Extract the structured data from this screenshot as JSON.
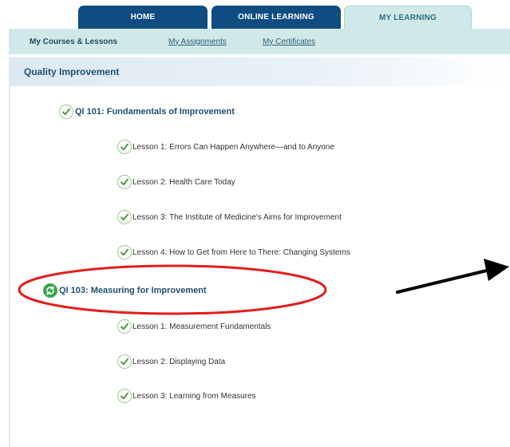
{
  "tabs": [
    {
      "label": "HOME",
      "active": false
    },
    {
      "label": "ONLINE LEARNING",
      "active": false
    },
    {
      "label": "MY LEARNING",
      "active": true
    }
  ],
  "subnav": {
    "current": "My Courses & Lessons",
    "links": [
      "My Assignments",
      "My Certificates"
    ]
  },
  "section": {
    "title": "Quality Improvement"
  },
  "courses": [
    {
      "title": "QI 101: Fundamentals of Improvement",
      "status_icon": "check-icon",
      "lessons": [
        {
          "title": "Lesson 1: Errors Can Happen Anywhere—and to Anyone",
          "status_icon": "check-icon"
        },
        {
          "title": "Lesson 2: Health Care Today",
          "status_icon": "check-icon"
        },
        {
          "title": "Lesson 3: The Institute of Medicine's Aims for Improvement",
          "status_icon": "check-icon"
        },
        {
          "title": "Lesson 4: How to Get from Here to There: Changing Systems",
          "status_icon": "check-icon"
        }
      ]
    },
    {
      "title": "QI 103: Measuring for Improvement",
      "status_icon": "in-progress-icon",
      "lessons": [
        {
          "title": "Lesson 1: Measurement Fundamentals",
          "status_icon": "check-icon"
        },
        {
          "title": "Lesson 2: Displaying Data",
          "status_icon": "check-icon"
        },
        {
          "title": "Lesson 3: Learning from Measures",
          "status_icon": "check-icon"
        }
      ]
    }
  ],
  "colors": {
    "tab_dark": "#0f4c81",
    "tab_light": "#cfe9e8",
    "annotation": "#e0201c",
    "check": "#4a9a3e"
  }
}
